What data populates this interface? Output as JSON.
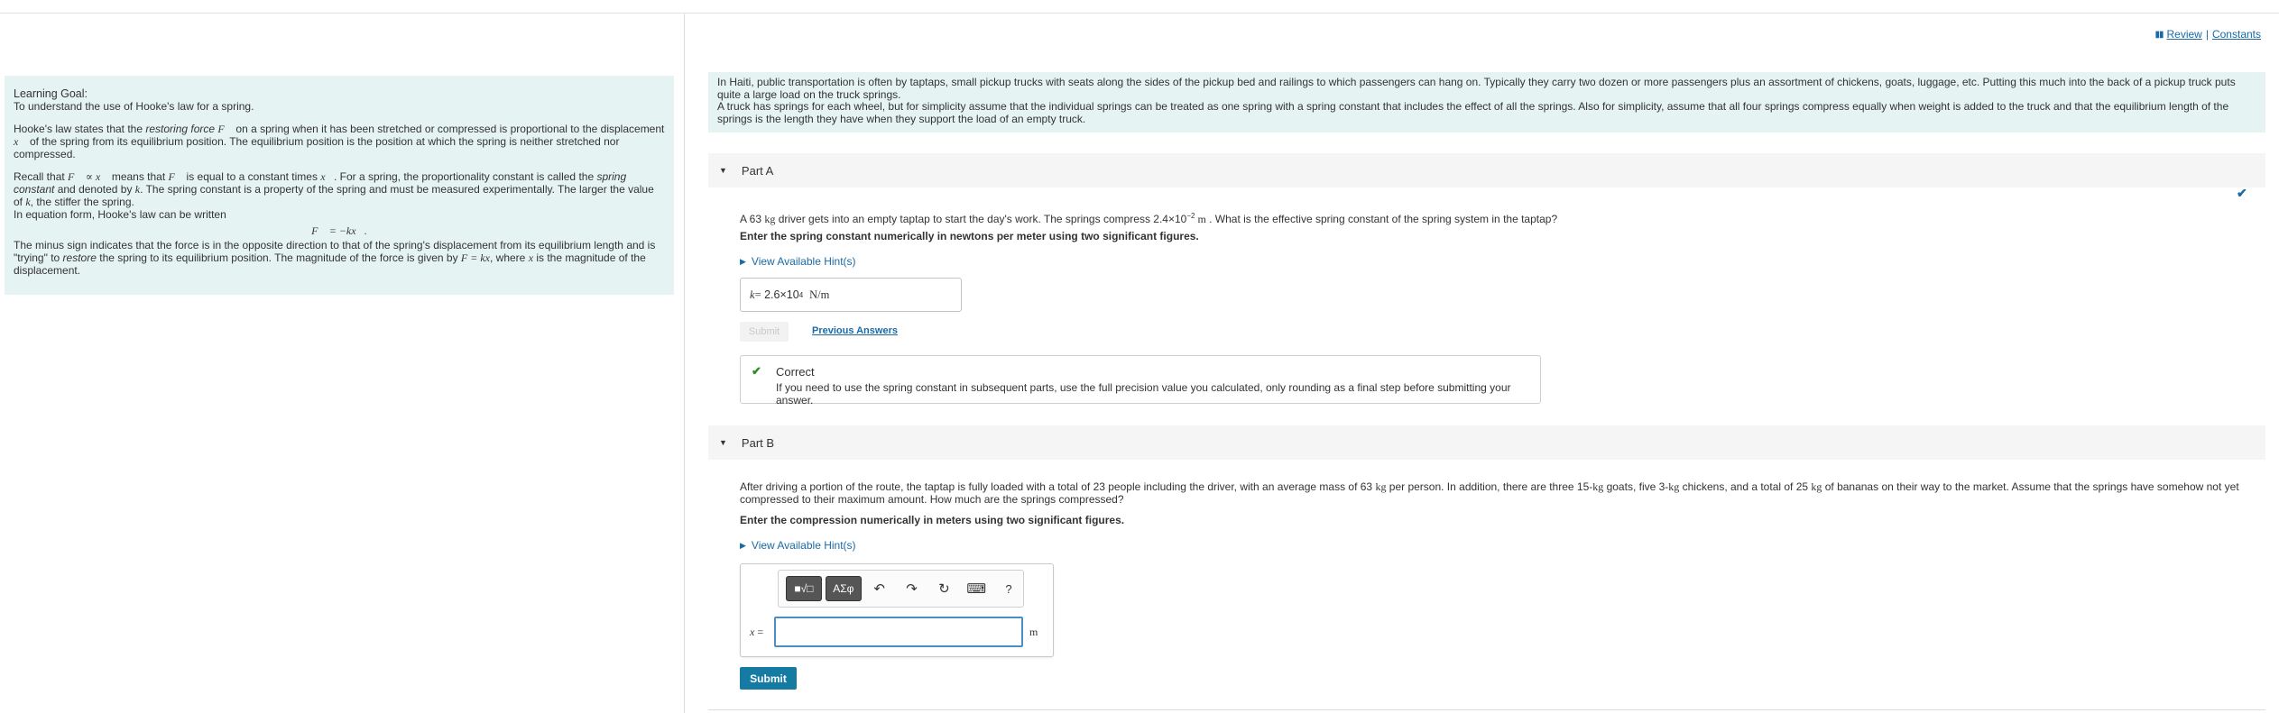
{
  "header": {
    "review_label": "Review",
    "separator": "|",
    "constants_label": "Constants"
  },
  "learning_goal": {
    "title": "Learning Goal:",
    "goal": "To understand the use of Hooke's law for a spring.",
    "p1_a": "Hooke's law states that the ",
    "p1_italic": "restoring force",
    "p1_b": " on a spring when it has been stretched or compressed is proportional to the displacement ",
    "p1_c": " of the spring from its equilibrium position. The equilibrium position is the position at which the spring is neither stretched nor compressed.",
    "p2_a": "Recall that ",
    "p2_b": " means that ",
    "p2_c": " is equal to a constant times ",
    "p2_d": ". For a spring, the proportionality constant is called the ",
    "p2_italic": "spring constant",
    "p2_e": " and denoted by ",
    "p2_f": ". The spring constant is a property of the spring and must be measured experimentally. The larger the value of ",
    "p2_g": ", the stiffer the spring.",
    "p3": "In equation form, Hooke's law can be written",
    "equation": "F⃗ = −kx⃗.",
    "p4_a": "The minus sign indicates that the force is in the opposite direction to that of the spring's displacement from its equilibrium length and is \"trying\" to ",
    "p4_italic": "restore",
    "p4_b": " the spring to its equilibrium position. The magnitude of the force is given by ",
    "p4_eq": "F = kx",
    "p4_c": ", where ",
    "p4_d": " is the magnitude of the displacement."
  },
  "intro": {
    "line1": "In Haiti, public transportation is often by taptaps, small pickup trucks with seats along the sides of the pickup bed and railings to which passengers can hang on. Typically they carry two dozen or more passengers plus an assortment of chickens, goats, luggage, etc. Putting this much into the back of a pickup truck puts quite a large load on the truck springs.",
    "line2": "A truck has springs for each wheel, but for simplicity assume that the individual springs can be treated as one spring with a spring constant that includes the effect of all the springs. Also for simplicity, assume that all four springs compress equally when weight is added to the truck and that the equilibrium length of the springs is the length they have when they support the load of an empty truck."
  },
  "part_a": {
    "title": "Part A",
    "question_a": "A 63 ",
    "question_unit": "kg",
    "question_b": " driver gets into an empty taptap to start the day's work. The springs compress 2.4×10",
    "question_exp": "−2",
    "question_unit2": " m",
    "question_c": " . What is the effective spring constant of the spring system in the taptap?",
    "instruction": "Enter the spring constant numerically in newtons per meter using two significant figures.",
    "hint_label": "View Available Hint(s)",
    "answer_var": "k",
    "answer_eq": " = ",
    "answer_value": "2.6×10",
    "answer_exp": "4",
    "answer_unit": "N/m",
    "submit_label": "Submit",
    "previous_answers_label": "Previous Answers",
    "feedback_title": "Correct",
    "feedback_message": "If you need to use the spring constant in subsequent parts, use the full precision value you calculated, only rounding as a final step before submitting your answer."
  },
  "part_b": {
    "title": "Part B",
    "question_a": "After driving a portion of the route, the taptap is fully loaded with a total of 23 people including the driver, with an average mass of 63 ",
    "question_b": " per person. In addition, there are three 15-",
    "question_c": " goats, five 3-",
    "question_d": " chickens, and a total of 25 ",
    "question_e": " of bananas on their way to the market. Assume that the springs have somehow not yet compressed to their maximum amount. How much are the springs compressed?",
    "unit_kg": "kg",
    "instruction": "Enter the compression numerically in meters using two significant figures.",
    "hint_label": "View Available Hint(s)",
    "toolbar": {
      "template_btn": "■√□",
      "greek_btn": "ΑΣφ",
      "undo": "↶",
      "redo": "↷",
      "reset": "↻",
      "keyboard": "⌨",
      "help": "?"
    },
    "input_var": "x",
    "input_eq": " =",
    "input_value": "",
    "input_unit": "m",
    "submit_label": "Submit"
  },
  "colors": {
    "accent_blue": "#1b6aa5",
    "submit_bg": "#167ba3",
    "info_bg": "#e5f3f3",
    "correct_green": "#2e8b2e"
  }
}
